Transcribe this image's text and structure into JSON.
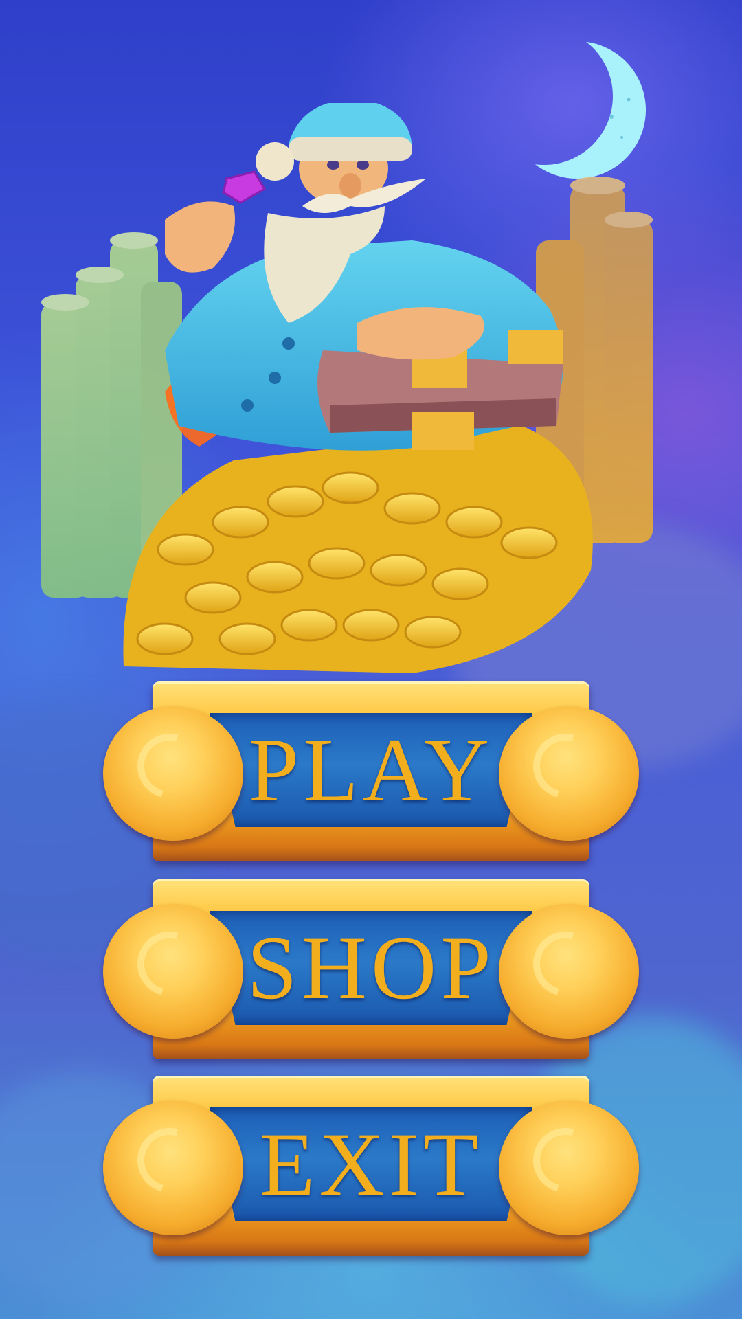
{
  "menu": {
    "play_label": "PLAY",
    "shop_label": "SHOP",
    "exit_label": "EXIT"
  },
  "scene": {
    "character": "wizard-gnome",
    "held_item": "purple-gem",
    "props": [
      "gold-coin-pile",
      "book",
      "crescent-moon"
    ]
  },
  "colors": {
    "button_gold": "#f5a723",
    "button_panel_blue": "#1d5fb8",
    "label_text": "#f2ae1c",
    "sky": "#3d52d8"
  }
}
